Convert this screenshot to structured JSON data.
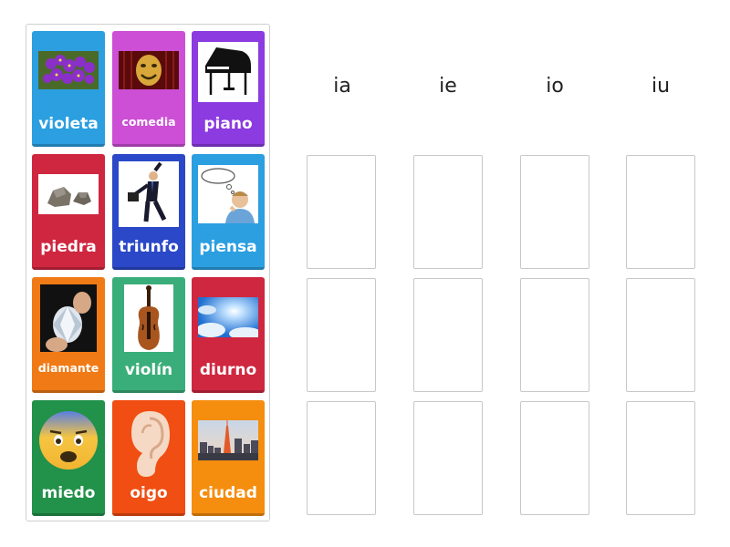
{
  "columns": [
    {
      "label": "ia"
    },
    {
      "label": "ie"
    },
    {
      "label": "io"
    },
    {
      "label": "iu"
    }
  ],
  "cards": [
    {
      "word": "violeta",
      "color": "#2b9fe0",
      "icon": "violet-flowers-icon"
    },
    {
      "word": "comedia",
      "color": "#cc4fd6",
      "icon": "comedy-mask-icon"
    },
    {
      "word": "piano",
      "color": "#8c3be0",
      "icon": "grand-piano-icon"
    },
    {
      "word": "piedra",
      "color": "#cf2740",
      "icon": "rocks-icon"
    },
    {
      "word": "triunfo",
      "color": "#2a48c7",
      "icon": "jumping-businessman-icon"
    },
    {
      "word": "piensa",
      "color": "#2b9fe0",
      "icon": "thinking-man-icon"
    },
    {
      "word": "diamante",
      "color": "#f07a16",
      "icon": "diamond-icon"
    },
    {
      "word": "violín",
      "color": "#3aae7a",
      "icon": "violin-icon"
    },
    {
      "word": "diurno",
      "color": "#cf2740",
      "icon": "sunny-sky-icon"
    },
    {
      "word": "miedo",
      "color": "#22914a",
      "icon": "fearful-face-icon"
    },
    {
      "word": "oigo",
      "color": "#f04e12",
      "icon": "ear-icon"
    },
    {
      "word": "ciudad",
      "color": "#f58d0f",
      "icon": "city-skyline-icon"
    }
  ]
}
